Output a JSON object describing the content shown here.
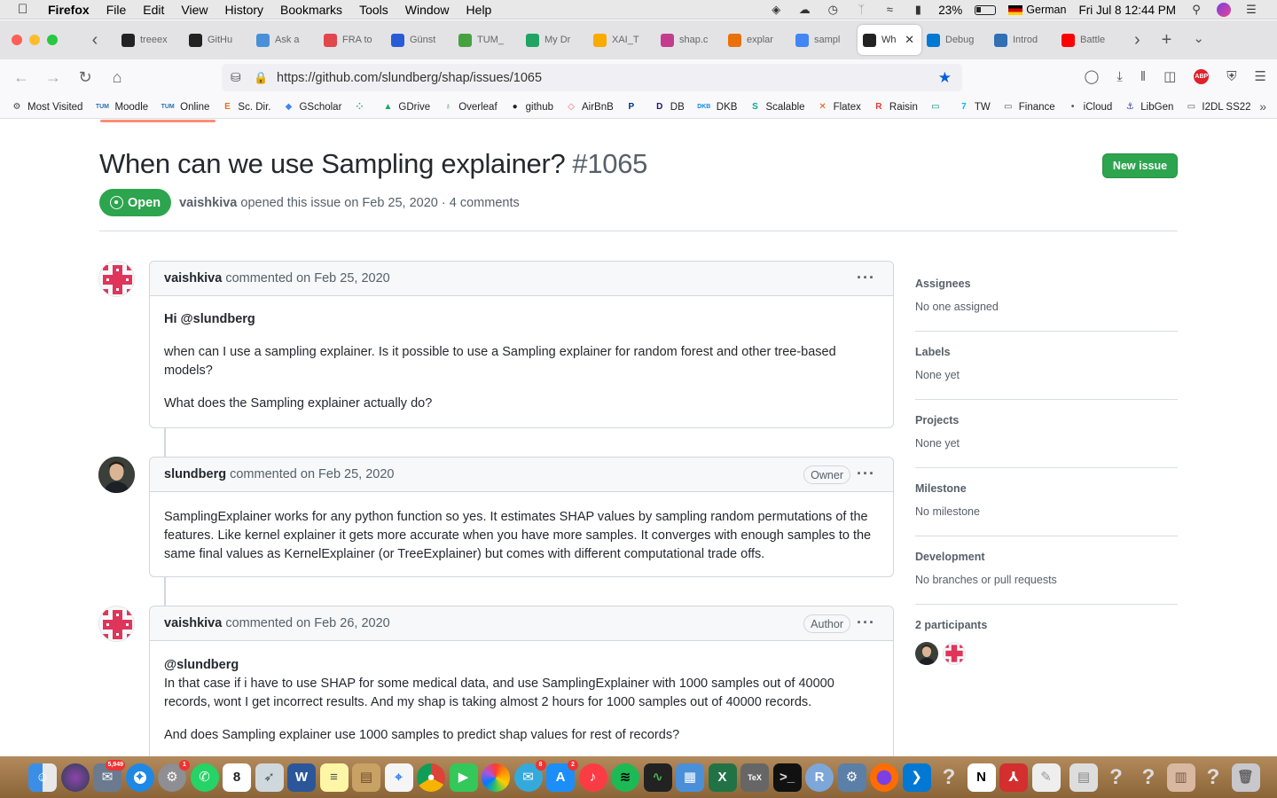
{
  "menubar": {
    "app": "Firefox",
    "items": [
      "File",
      "Edit",
      "View",
      "History",
      "Bookmarks",
      "Tools",
      "Window",
      "Help"
    ],
    "battery": "23%",
    "input_source": "German",
    "datetime": "Fri Jul 8  12:44 PM"
  },
  "tabs": [
    {
      "label": "treeex",
      "icon": "github-icon",
      "color": "#222"
    },
    {
      "label": "GitHu",
      "icon": "github-icon",
      "color": "#222"
    },
    {
      "label": "Ask a",
      "icon": "datascience-icon",
      "color": "#4a90d9"
    },
    {
      "label": "FRA to",
      "icon": "pinwheel-icon",
      "color": "#e0484d"
    },
    {
      "label": "Günst",
      "icon": "flight-icon",
      "color": "#2a5bd7"
    },
    {
      "label": "TUM_",
      "icon": "overleaf-icon",
      "color": "#47a141"
    },
    {
      "label": "My Dr",
      "icon": "gdrive-icon",
      "color": "#1fa463"
    },
    {
      "label": "XAI_T",
      "icon": "colab-icon",
      "color": "#f9ab00"
    },
    {
      "label": "shap.c",
      "icon": "shap-icon",
      "color": "#c43c8e"
    },
    {
      "label": "explar",
      "icon": "colab-icon",
      "color": "#e8710a"
    },
    {
      "label": "sampl",
      "icon": "google-icon",
      "color": "#4285f4"
    },
    {
      "label": "Wh",
      "icon": "github-icon",
      "color": "#222",
      "active": true
    },
    {
      "label": "Debug",
      "icon": "vscode-icon",
      "color": "#0078d4"
    },
    {
      "label": "Introd",
      "icon": "tum-icon",
      "color": "#3070b3"
    },
    {
      "label": "Battle",
      "icon": "youtube-icon",
      "color": "#ff0000"
    }
  ],
  "url": "https://github.com/slundberg/shap/issues/1065",
  "bookmarks": [
    {
      "label": "Most Visited",
      "icon": "gear-icon"
    },
    {
      "label": "Moodle",
      "icon": "tum-icon"
    },
    {
      "label": "Online",
      "icon": "tum-icon"
    },
    {
      "label": "Sc. Dir.",
      "icon": "elsevier-icon"
    },
    {
      "label": "GScholar",
      "icon": "scholar-icon"
    },
    {
      "label": "",
      "icon": "apps-icon"
    },
    {
      "label": "GDrive",
      "icon": "gdrive-icon"
    },
    {
      "label": "Overleaf",
      "icon": "overleaf-icon"
    },
    {
      "label": "github",
      "icon": "github-icon"
    },
    {
      "label": "AirBnB",
      "icon": "airbnb-icon"
    },
    {
      "label": "",
      "icon": "paypal-icon"
    },
    {
      "label": "DB",
      "icon": "db-icon"
    },
    {
      "label": "DKB",
      "icon": "dkb-icon"
    },
    {
      "label": "Scalable",
      "icon": "scalable-icon"
    },
    {
      "label": "Flatex",
      "icon": "flatex-icon"
    },
    {
      "label": "Raisin",
      "icon": "raisin-icon"
    },
    {
      "label": "",
      "icon": "card-icon"
    },
    {
      "label": "TW",
      "icon": "tw-icon"
    },
    {
      "label": "Finance",
      "icon": "folder-icon"
    },
    {
      "label": "iCloud",
      "icon": "apple-icon"
    },
    {
      "label": "LibGen",
      "icon": "libgen-icon"
    },
    {
      "label": "I2DL SS22",
      "icon": "folder-icon"
    }
  ],
  "issue": {
    "title": "When can we use Sampling explainer?",
    "number": "#1065",
    "new_issue_label": "New issue",
    "state": "Open",
    "author": "vaishkiva",
    "meta": "opened this issue on Feb 25, 2020 · 4 comments"
  },
  "comments": [
    {
      "author": "vaishkiva",
      "meta": "commented on Feb 25, 2020",
      "badge": "",
      "mention": "Hi @slundberg",
      "paragraphs": [
        "when can I use a sampling explainer. Is it possible to use a Sampling explainer for random forest and other tree-based models?",
        "What does the Sampling explainer actually do?"
      ]
    },
    {
      "author": "slundberg",
      "meta": "commented on Feb 25, 2020",
      "badge": "Owner",
      "paragraphs": [
        "SamplingExplainer works for any python function so yes. It estimates SHAP values by sampling random permutations of the features. Like kernel explainer it gets more accurate when you have more samples. It converges with enough samples to the same final values as KernelExplainer (or TreeExplainer) but comes with different computational trade offs."
      ]
    },
    {
      "author": "vaishkiva",
      "meta": "commented on Feb 26, 2020",
      "badge": "Author",
      "mention": "@slundberg",
      "paragraphs": [
        "In that case if i have to use SHAP for some medical data, and use SamplingExplainer with 1000 samples out of 40000 records, wont I get incorrect results. And my shap is taking almost 2 hours for 1000 samples out of 40000 records.",
        "And does Sampling explainer use 1000 samples to predict shap values for rest of records?"
      ]
    }
  ],
  "sidebar": {
    "assignees": {
      "title": "Assignees",
      "value": "No one assigned"
    },
    "labels": {
      "title": "Labels",
      "value": "None yet"
    },
    "projects": {
      "title": "Projects",
      "value": "None yet"
    },
    "milestone": {
      "title": "Milestone",
      "value": "No milestone"
    },
    "development": {
      "title": "Development",
      "value": "No branches or pull requests"
    },
    "participants": {
      "title": "2 participants"
    }
  },
  "dock": {
    "badges": {
      "mail": "5,949",
      "settings": "1",
      "messages": "8",
      "appstore": "2"
    },
    "calendar_day": "8"
  },
  "colors": {
    "github_green": "#2da44e",
    "identicon": "#e0355a"
  }
}
